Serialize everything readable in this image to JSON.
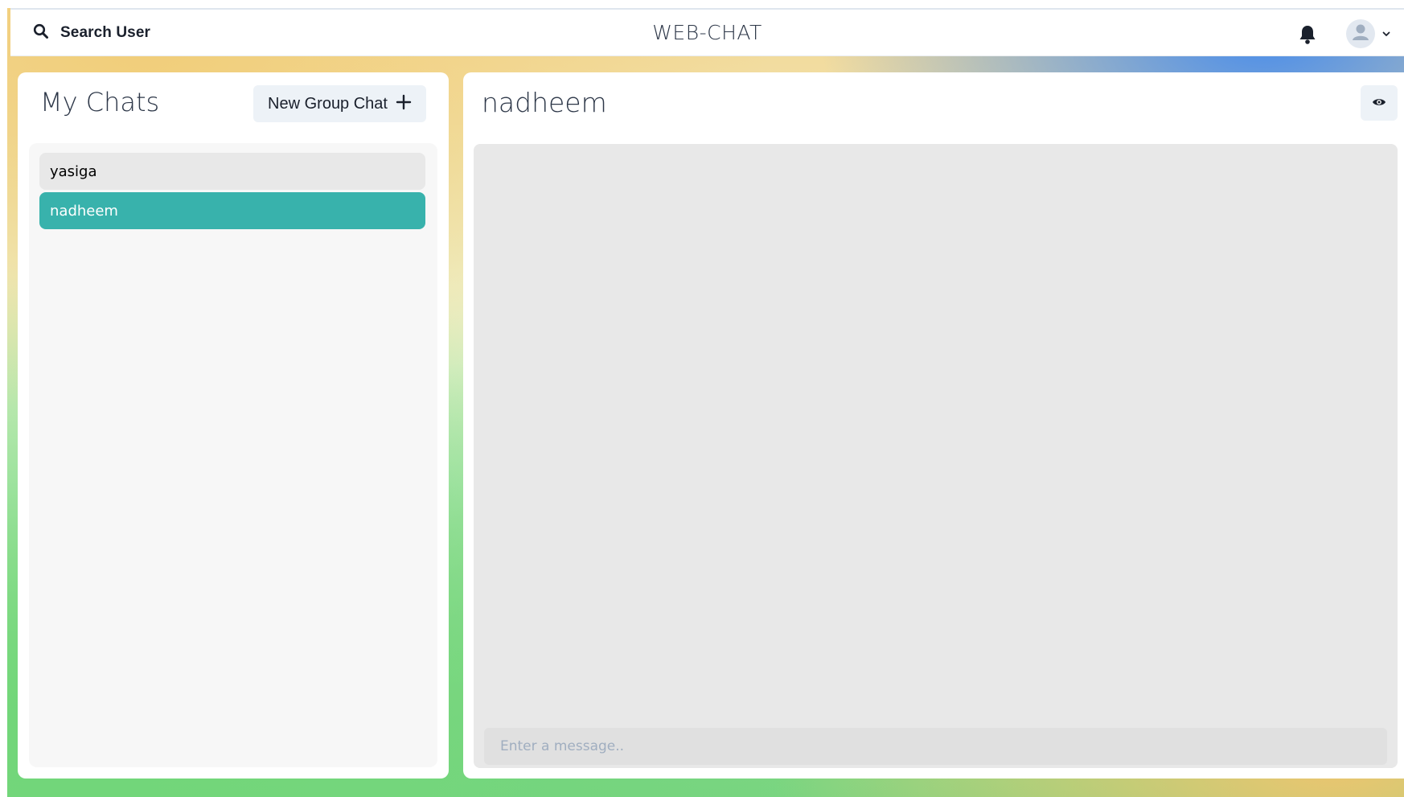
{
  "header": {
    "search_label": "Search User",
    "app_title": "WEB-CHAT",
    "icons": {
      "search": "search-icon",
      "notifications": "bell-icon",
      "avatar": "user-avatar-icon",
      "menu": "chevron-down-icon"
    }
  },
  "sidebar": {
    "title": "My Chats",
    "new_group_label": "New Group Chat",
    "new_group_icon": "plus-icon",
    "chats": [
      {
        "name": "yasiga",
        "selected": false
      },
      {
        "name": "nadheem",
        "selected": true
      }
    ]
  },
  "chat": {
    "title": "nadheem",
    "view_profile_icon": "eye-icon",
    "input": {
      "placeholder": "Enter a message..",
      "value": ""
    }
  },
  "colors": {
    "accent": "#38b2ac",
    "button_bg": "#edf2f7",
    "panel_bg": "#ffffff",
    "list_bg": "#f7f7f7",
    "messages_bg": "#e8e8e8"
  }
}
